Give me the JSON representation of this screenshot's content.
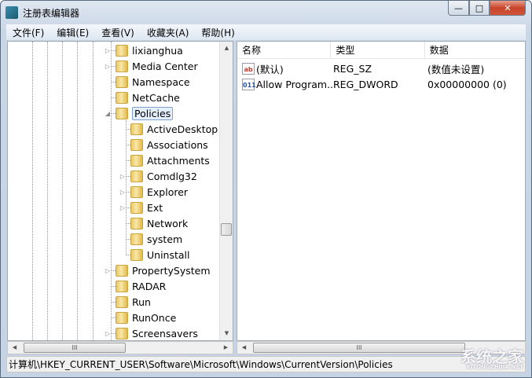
{
  "window": {
    "title": "注册表编辑器",
    "minimize": "—",
    "maximize": "□",
    "close": "✕"
  },
  "menu": [
    "文件(F)",
    "编辑(E)",
    "查看(V)",
    "收藏夹(A)",
    "帮助(H)"
  ],
  "tree": [
    {
      "label": "lixianghua",
      "level": 1,
      "expander": "collapsed"
    },
    {
      "label": "Media Center",
      "level": 1,
      "expander": "collapsed"
    },
    {
      "label": "Namespace",
      "level": 1,
      "expander": "none"
    },
    {
      "label": "NetCache",
      "level": 1,
      "expander": "none"
    },
    {
      "label": "Policies",
      "level": 1,
      "expander": "expanded",
      "selected": true
    },
    {
      "label": "ActiveDesktop",
      "level": 2,
      "expander": "none"
    },
    {
      "label": "Associations",
      "level": 2,
      "expander": "none"
    },
    {
      "label": "Attachments",
      "level": 2,
      "expander": "none"
    },
    {
      "label": "Comdlg32",
      "level": 2,
      "expander": "collapsed"
    },
    {
      "label": "Explorer",
      "level": 2,
      "expander": "collapsed"
    },
    {
      "label": "Ext",
      "level": 2,
      "expander": "collapsed"
    },
    {
      "label": "Network",
      "level": 2,
      "expander": "none"
    },
    {
      "label": "system",
      "level": 2,
      "expander": "none"
    },
    {
      "label": "Uninstall",
      "level": 2,
      "expander": "none"
    },
    {
      "label": "PropertySystem",
      "level": 1,
      "expander": "collapsed"
    },
    {
      "label": "RADAR",
      "level": 1,
      "expander": "none"
    },
    {
      "label": "Run",
      "level": 1,
      "expander": "none"
    },
    {
      "label": "RunOnce",
      "level": 1,
      "expander": "none"
    },
    {
      "label": "Screensavers",
      "level": 1,
      "expander": "collapsed"
    }
  ],
  "list": {
    "columns": [
      "名称",
      "类型",
      "数据"
    ],
    "rows": [
      {
        "icon": "string-value-icon",
        "icon_text": "ab",
        "name": "(默认)",
        "type": "REG_SZ",
        "data": "(数值未设置)"
      },
      {
        "icon": "dword-value-icon",
        "icon_text": "011",
        "name": "Allow Program...",
        "type": "REG_DWORD",
        "data": "0x00000000 (0)"
      }
    ]
  },
  "scroll_grip": "III",
  "status": "计算机\\HKEY_CURRENT_USER\\Software\\Microsoft\\Windows\\CurrentVersion\\Policies",
  "watermark": {
    "text": "系统之家",
    "sub": "XITONGZHIJIA.NET"
  }
}
